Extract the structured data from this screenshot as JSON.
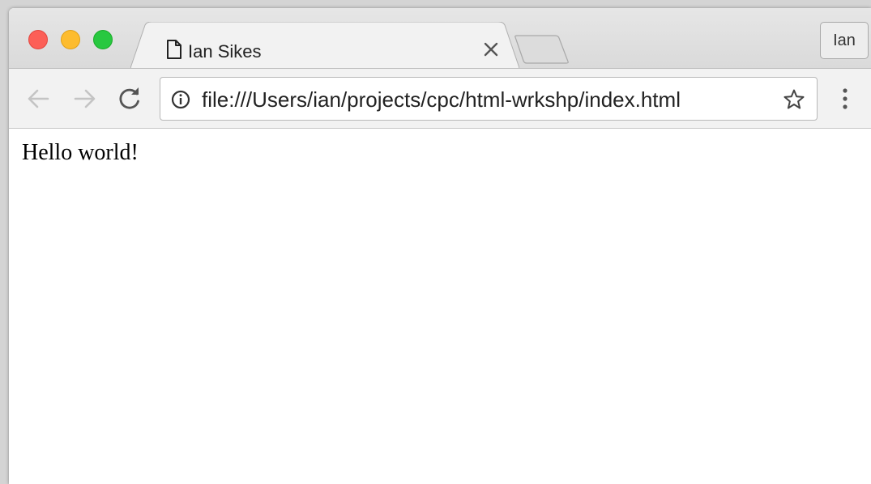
{
  "window": {
    "traffic_lights": [
      "close",
      "minimize",
      "zoom"
    ],
    "colors": {
      "close": "#fc5f57",
      "minimize": "#fdbc2e",
      "zoom": "#28c840"
    }
  },
  "tab": {
    "title": "Ian Sikes",
    "favicon": "page-icon",
    "close_icon": "close-icon"
  },
  "profile": {
    "label": "Ian"
  },
  "toolbar": {
    "back_icon": "arrow-left-icon",
    "forward_icon": "arrow-right-icon",
    "reload_icon": "reload-icon",
    "menu_icon": "kebab-menu-icon"
  },
  "omnibox": {
    "url": "file:///Users/ian/projects/cpc/html-wrkshp/index.html",
    "info_icon": "info-icon",
    "bookmark_icon": "star-icon"
  },
  "page": {
    "body_text": "Hello world!"
  }
}
